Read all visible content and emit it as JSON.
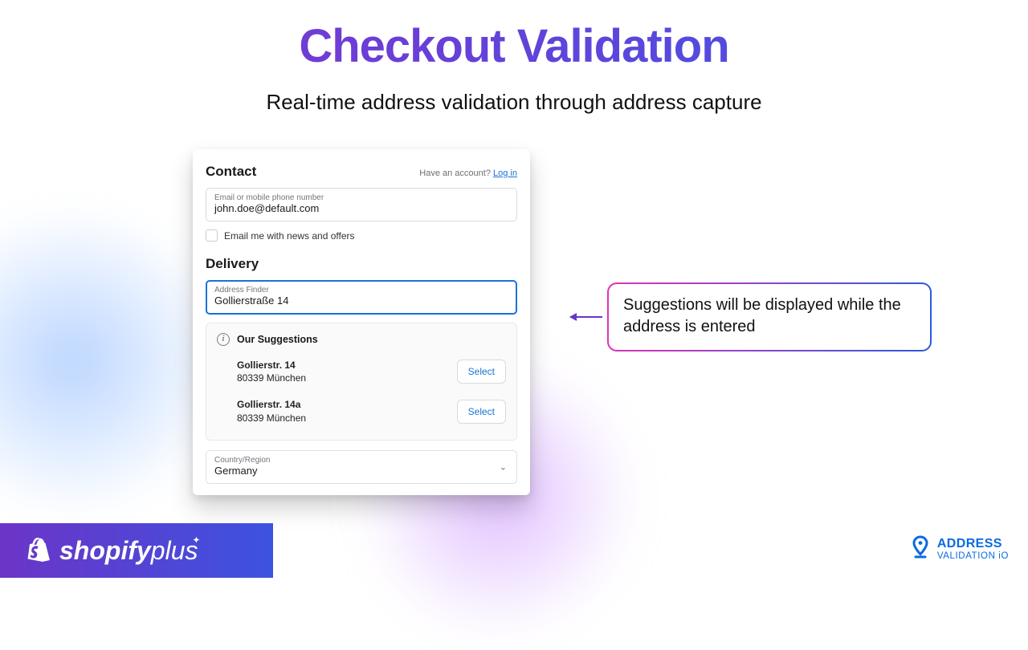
{
  "headline": "Checkout Validation",
  "subhead": "Real-time address validation through address capture",
  "card": {
    "contact_title": "Contact",
    "account_prompt": "Have an account?",
    "login_label": "Log in",
    "email_label": "Email or mobile phone number",
    "email_value": "john.doe@default.com",
    "news_label": "Email me with news and offers",
    "delivery_title": "Delivery",
    "addr_finder_label": "Address Finder",
    "addr_finder_value": "Gollierstraße 14",
    "suggestions_title": "Our Suggestions",
    "suggestions": [
      {
        "line1": "Gollierstr. 14",
        "line2": "80339 München",
        "select": "Select"
      },
      {
        "line1": "Gollierstr. 14a",
        "line2": "80339 München",
        "select": "Select"
      }
    ],
    "country_label": "Country/Region",
    "country_value": "Germany"
  },
  "callout": "Suggestions will be displayed while the address is entered",
  "footer": {
    "shopify": "shopifyplus",
    "addrval_l1": "ADDRESS",
    "addrval_l2": "VALIDATION iO"
  }
}
